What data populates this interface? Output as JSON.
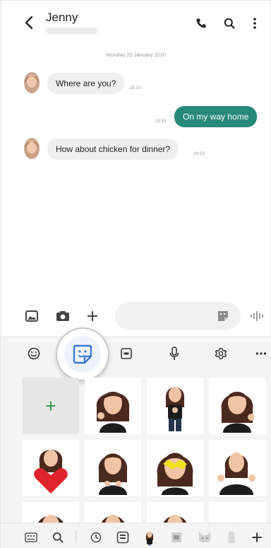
{
  "header": {
    "contact_name": "Jenny"
  },
  "conversation": {
    "date_divider": "Monday 20 January 2020",
    "messages": [
      {
        "direction": "in",
        "text": "Where are you?",
        "time": "19:33"
      },
      {
        "direction": "out",
        "text": "On my way home",
        "time": "19:33"
      },
      {
        "direction": "in",
        "text": "How about chicken for dinner?",
        "time": "19:33"
      }
    ]
  },
  "composer": {
    "input_value": ""
  },
  "keyboard": {
    "toolbar_icons": [
      "emoji-icon",
      "sticker-icon",
      "gif-icon",
      "mic-icon",
      "settings-icon",
      "more-icon"
    ],
    "sticker_grid": {
      "add_tile_label": "+"
    },
    "bottom_icons": [
      "keyboard-icon",
      "search-icon",
      "recent-icon",
      "sticker-tab-icon",
      "ar-emoji-icon",
      "pack-icon",
      "cat-pack-icon",
      "pack-icon-2",
      "add-pack-icon"
    ]
  },
  "colors": {
    "accent": "#27897a",
    "highlight": "#3d78d4",
    "add_plus": "#2f9a45"
  }
}
